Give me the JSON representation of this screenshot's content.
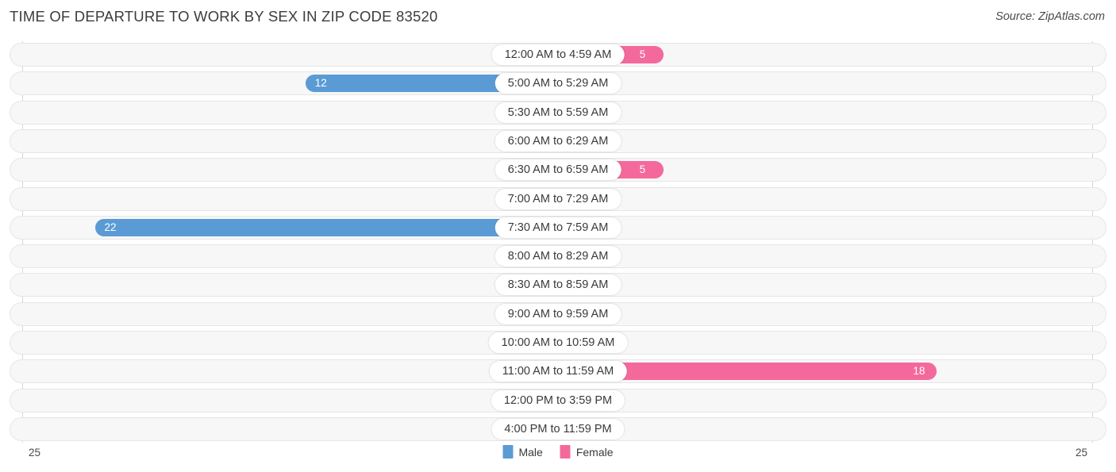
{
  "header": {
    "title": "TIME OF DEPARTURE TO WORK BY SEX IN ZIP CODE 83520",
    "source": "Source: ZipAtlas.com"
  },
  "axis": {
    "left_tick": "25",
    "right_tick": "25"
  },
  "legend": {
    "items": [
      {
        "label": "Male",
        "color": "#5b9bd5"
      },
      {
        "label": "Female",
        "color": "#f4699b"
      }
    ]
  },
  "colors": {
    "male_light": "#a9c9ec",
    "male_dark": "#5b9bd5",
    "female_light": "#f9afc8",
    "female_dark": "#f4699b",
    "track": "#f7f7f7"
  },
  "chart_data": {
    "type": "bar",
    "orientation": "horizontal-diverging",
    "title": "TIME OF DEPARTURE TO WORK BY SEX IN ZIP CODE 83520",
    "xlabel": "",
    "ylabel": "",
    "xlim": [
      25,
      25
    ],
    "grid": false,
    "legend_position": "bottom-center",
    "categories": [
      "12:00 AM to 4:59 AM",
      "5:00 AM to 5:29 AM",
      "5:30 AM to 5:59 AM",
      "6:00 AM to 6:29 AM",
      "6:30 AM to 6:59 AM",
      "7:00 AM to 7:29 AM",
      "7:30 AM to 7:59 AM",
      "8:00 AM to 8:29 AM",
      "8:30 AM to 8:59 AM",
      "9:00 AM to 9:59 AM",
      "10:00 AM to 10:59 AM",
      "11:00 AM to 11:59 AM",
      "12:00 PM to 3:59 PM",
      "4:00 PM to 11:59 PM"
    ],
    "series": [
      {
        "name": "Male",
        "values": [
          0,
          12,
          0,
          0,
          0,
          0,
          22,
          0,
          0,
          0,
          0,
          0,
          0,
          0
        ]
      },
      {
        "name": "Female",
        "values": [
          5,
          0,
          0,
          0,
          5,
          0,
          0,
          0,
          0,
          0,
          0,
          18,
          0,
          0
        ]
      }
    ],
    "rows": [
      {
        "category": "12:00 AM to 4:59 AM",
        "male": "0",
        "female": "5"
      },
      {
        "category": "5:00 AM to 5:29 AM",
        "male": "12",
        "female": "0"
      },
      {
        "category": "5:30 AM to 5:59 AM",
        "male": "0",
        "female": "0"
      },
      {
        "category": "6:00 AM to 6:29 AM",
        "male": "0",
        "female": "0"
      },
      {
        "category": "6:30 AM to 6:59 AM",
        "male": "0",
        "female": "5"
      },
      {
        "category": "7:00 AM to 7:29 AM",
        "male": "0",
        "female": "0"
      },
      {
        "category": "7:30 AM to 7:59 AM",
        "male": "22",
        "female": "0"
      },
      {
        "category": "8:00 AM to 8:29 AM",
        "male": "0",
        "female": "0"
      },
      {
        "category": "8:30 AM to 8:59 AM",
        "male": "0",
        "female": "0"
      },
      {
        "category": "9:00 AM to 9:59 AM",
        "male": "0",
        "female": "0"
      },
      {
        "category": "10:00 AM to 10:59 AM",
        "male": "0",
        "female": "0"
      },
      {
        "category": "11:00 AM to 11:59 AM",
        "male": "0",
        "female": "18"
      },
      {
        "category": "12:00 PM to 3:59 PM",
        "male": "0",
        "female": "0"
      },
      {
        "category": "4:00 PM to 11:59 PM",
        "male": "0",
        "female": "0"
      }
    ]
  }
}
